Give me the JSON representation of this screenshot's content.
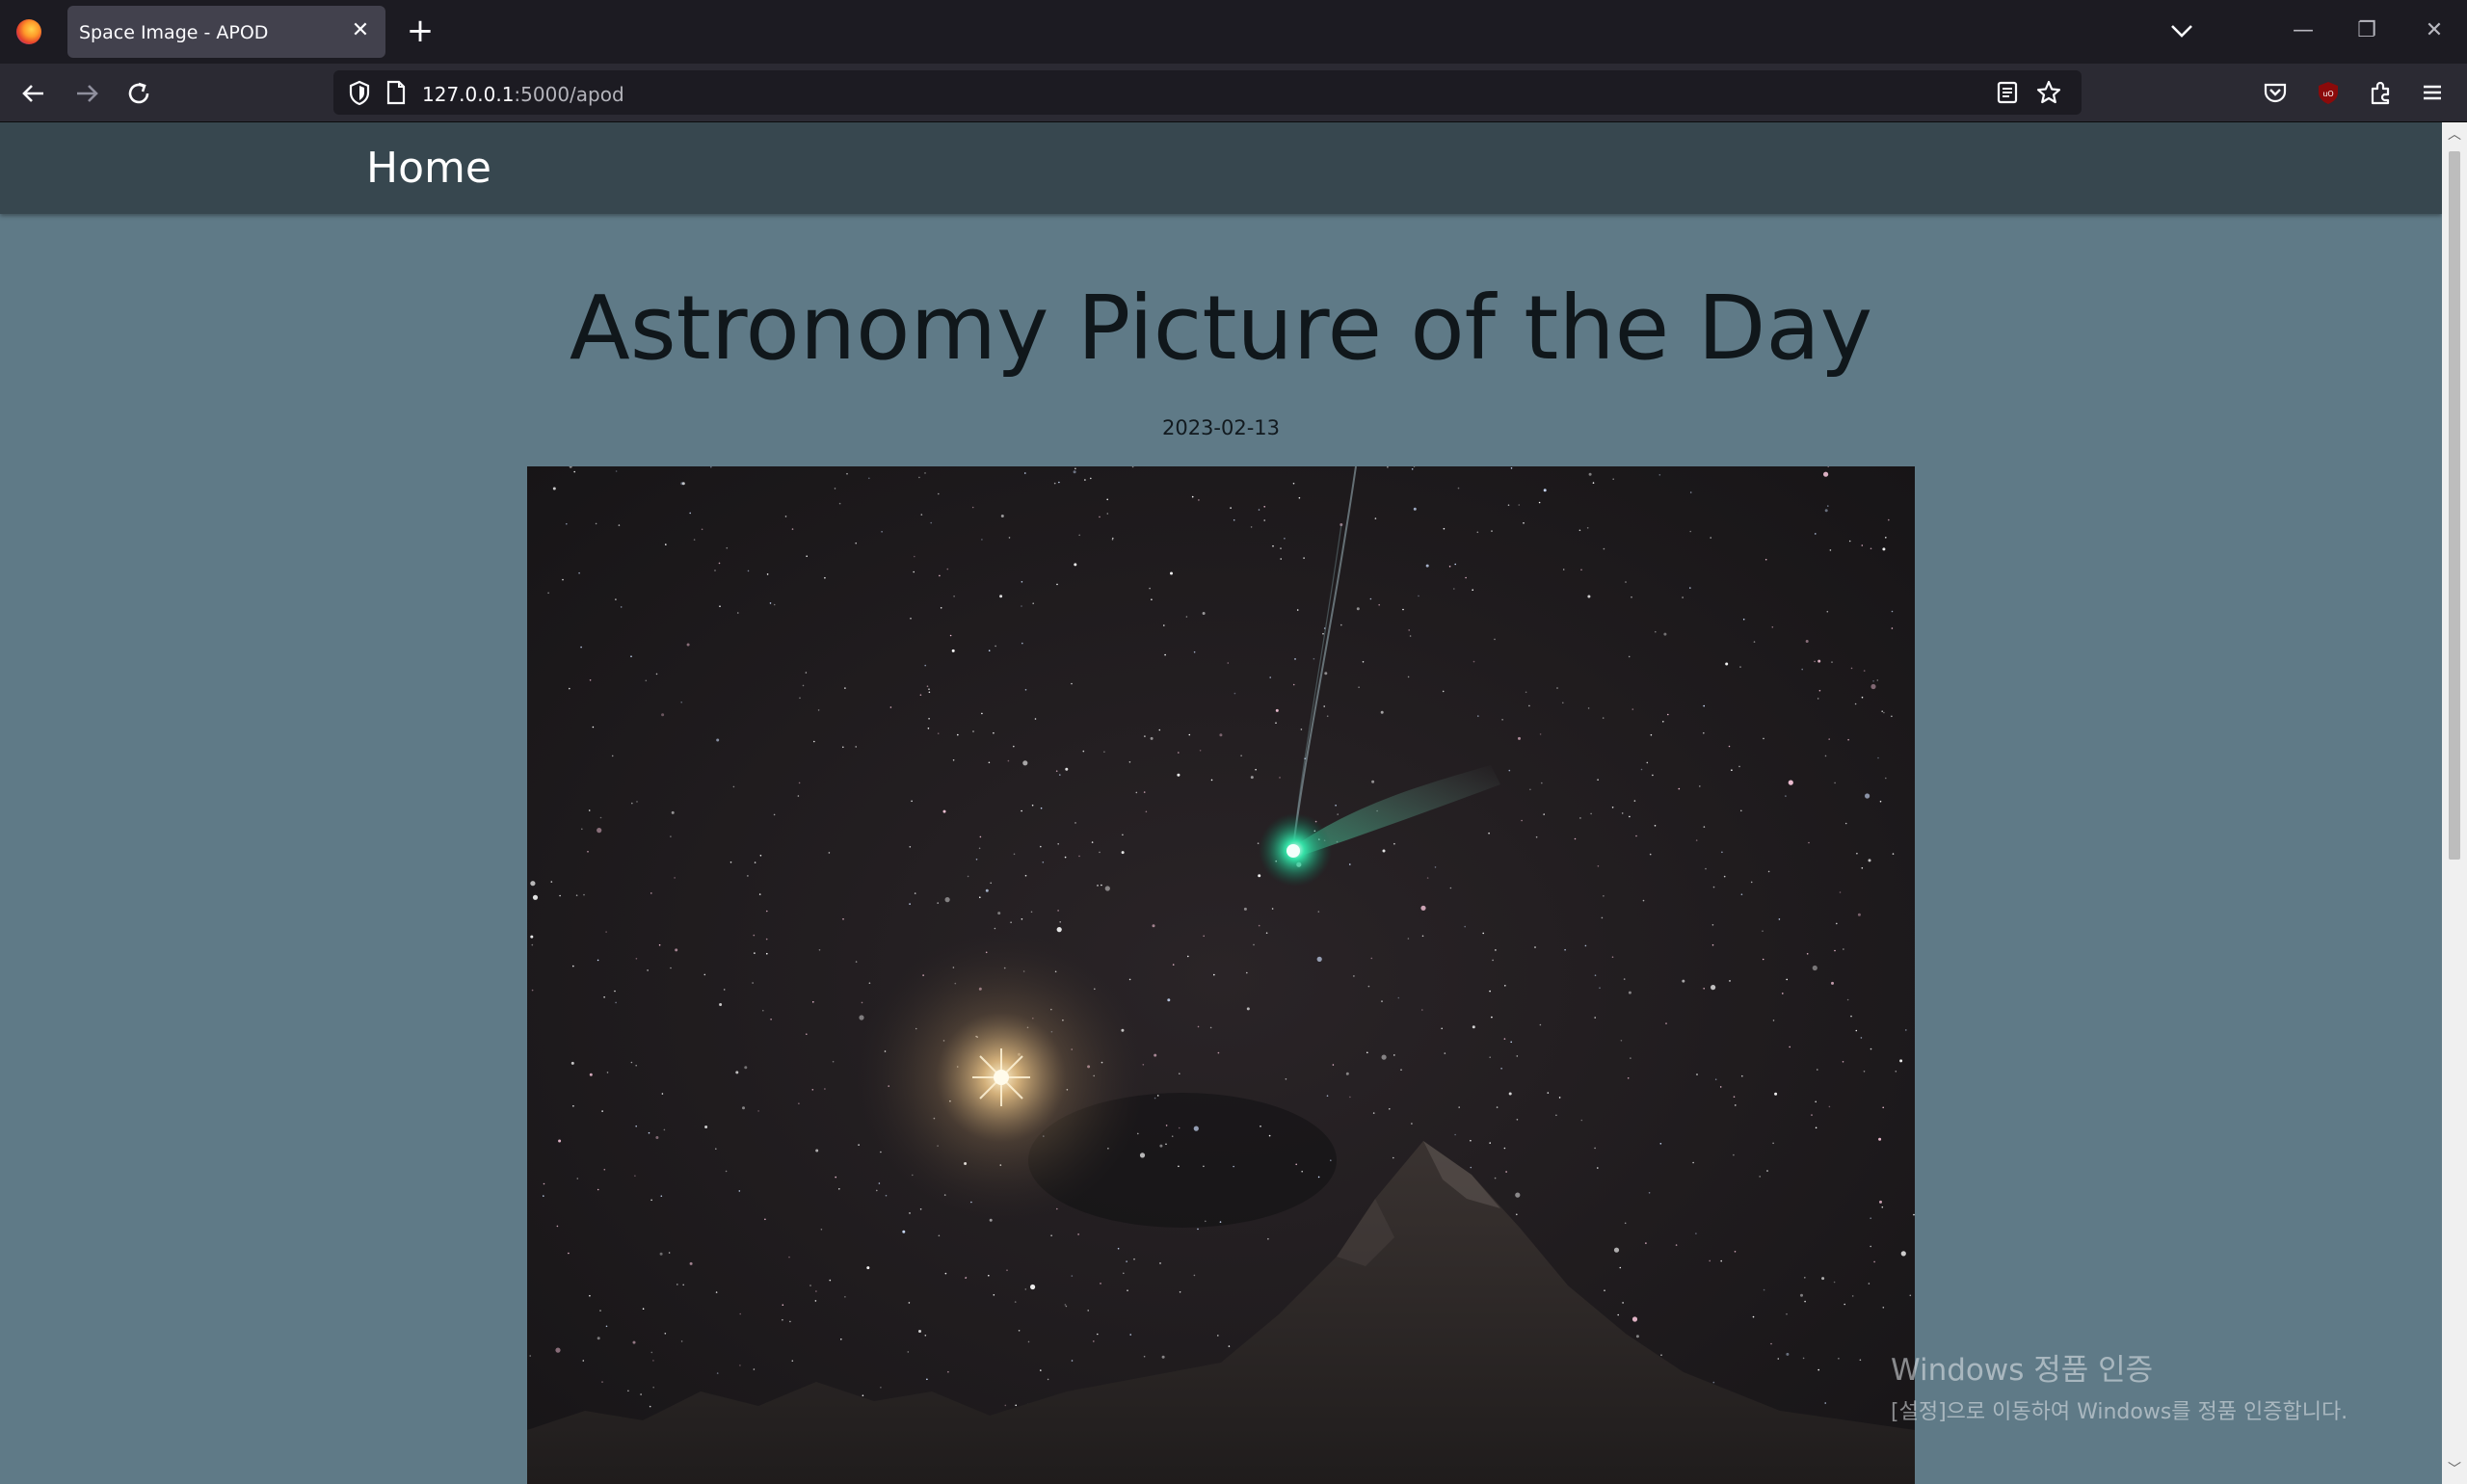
{
  "browser": {
    "tab": {
      "title": "Space Image - APOD",
      "close_glyph": "✕"
    },
    "new_tab_glyph": "+",
    "window_controls": {
      "minimize": "—",
      "restore": "❐",
      "close": "✕"
    },
    "url": {
      "host": "127.0.0.1",
      "path": ":5000/apod"
    },
    "icons": [
      "firefox-logo",
      "back-icon",
      "forward-icon",
      "reload-icon",
      "shield-icon",
      "page-icon",
      "reader-mode-icon",
      "bookmark-star-icon",
      "pocket-icon",
      "ublock-icon",
      "extensions-icon",
      "menu-icon",
      "tab-list-chevron-icon"
    ]
  },
  "site": {
    "nav": {
      "home_label": "Home"
    },
    "title": "Astronomy Picture of the Day",
    "date": "2023-02-13",
    "image": {
      "description_icon": "comet-night-sky-photo"
    }
  },
  "scrollbar": {
    "up": "︿",
    "down": "﹀"
  },
  "windows_activation": {
    "title": "Windows 정품 인증",
    "subtitle": "[설정]으로 이동하여 Windows를 정품 인증합니다."
  }
}
